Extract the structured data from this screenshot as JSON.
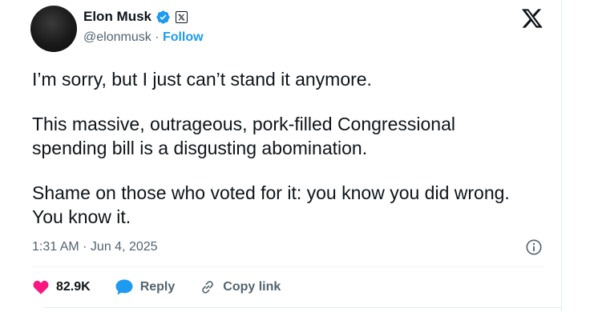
{
  "user": {
    "display_name": "Elon Musk",
    "handle": "@elonmusk",
    "separator": " · ",
    "follow_label": "Follow"
  },
  "icons": {
    "verified": "verified-badge-icon",
    "affiliate": "x-badge-icon",
    "brand": "x-logo-icon",
    "info": "info-icon",
    "like": "heart-icon",
    "reply": "reply-bubble-icon",
    "copy": "link-icon"
  },
  "tweet": {
    "paragraphs": [
      "I’m sorry, but I just can’t stand it anymore.",
      "This massive, outrageous, pork-filled Congressional spending bill is a disgusting abomination.",
      "Shame on those who voted for it: you know you did wrong. You know it."
    ],
    "timestamp": "1:31 AM · Jun 4, 2025"
  },
  "actions": {
    "like_count": "82.9K",
    "reply_label": "Reply",
    "copy_label": "Copy link"
  },
  "colors": {
    "brand_blue": "#1d9bf0",
    "like_red": "#f91880",
    "text": "#0f1419",
    "muted": "#536471"
  }
}
